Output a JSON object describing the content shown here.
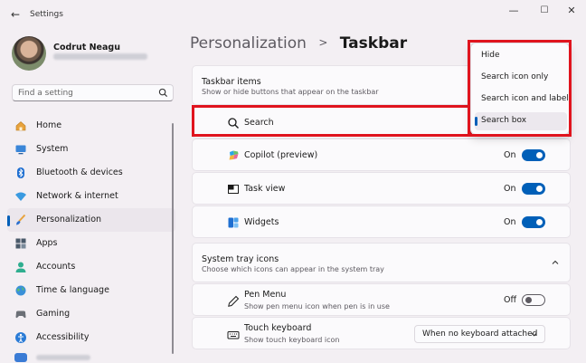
{
  "window": {
    "title": "Settings",
    "controls": {
      "minimize": "—",
      "maximize": "☐",
      "close": "✕"
    }
  },
  "user": {
    "name": "Codrut Neagu"
  },
  "search": {
    "placeholder": "Find a setting"
  },
  "nav": {
    "items": [
      {
        "label": "Home",
        "icon": "home-icon"
      },
      {
        "label": "System",
        "icon": "monitor-icon"
      },
      {
        "label": "Bluetooth & devices",
        "icon": "bluetooth-icon"
      },
      {
        "label": "Network & internet",
        "icon": "wifi-icon"
      },
      {
        "label": "Personalization",
        "icon": "brush-icon",
        "active": true
      },
      {
        "label": "Apps",
        "icon": "apps-icon"
      },
      {
        "label": "Accounts",
        "icon": "person-icon"
      },
      {
        "label": "Time & language",
        "icon": "globe-icon"
      },
      {
        "label": "Gaming",
        "icon": "gamepad-icon"
      },
      {
        "label": "Accessibility",
        "icon": "accessibility-icon"
      }
    ]
  },
  "breadcrumb": {
    "parent": "Personalization",
    "separator": ">",
    "current": "Taskbar"
  },
  "taskbar_items": {
    "title": "Taskbar items",
    "subtitle": "Show or hide buttons that appear on the taskbar",
    "rows": [
      {
        "label": "Search",
        "icon": "search-icon"
      },
      {
        "label": "Copilot (preview)",
        "icon": "copilot-icon",
        "state": "On",
        "on": true
      },
      {
        "label": "Task view",
        "icon": "task-view-icon",
        "state": "On",
        "on": true
      },
      {
        "label": "Widgets",
        "icon": "widgets-icon",
        "state": "On",
        "on": true
      }
    ]
  },
  "system_tray": {
    "title": "System tray icons",
    "subtitle": "Choose which icons can appear in the system tray",
    "rows": [
      {
        "label": "Pen Menu",
        "sublabel": "Show pen menu icon when pen is in use",
        "icon": "pen-icon",
        "state": "Off",
        "on": false
      },
      {
        "label": "Touch keyboard",
        "sublabel": "Show touch keyboard icon",
        "icon": "keyboard-icon",
        "dropdown_value": "When no keyboard attached"
      }
    ]
  },
  "search_menu": {
    "options": [
      "Hide",
      "Search icon only",
      "Search icon and label",
      "Search box"
    ],
    "selected": "Search box"
  },
  "colors": {
    "accent": "#005fb8",
    "highlight": "#e0141e"
  }
}
